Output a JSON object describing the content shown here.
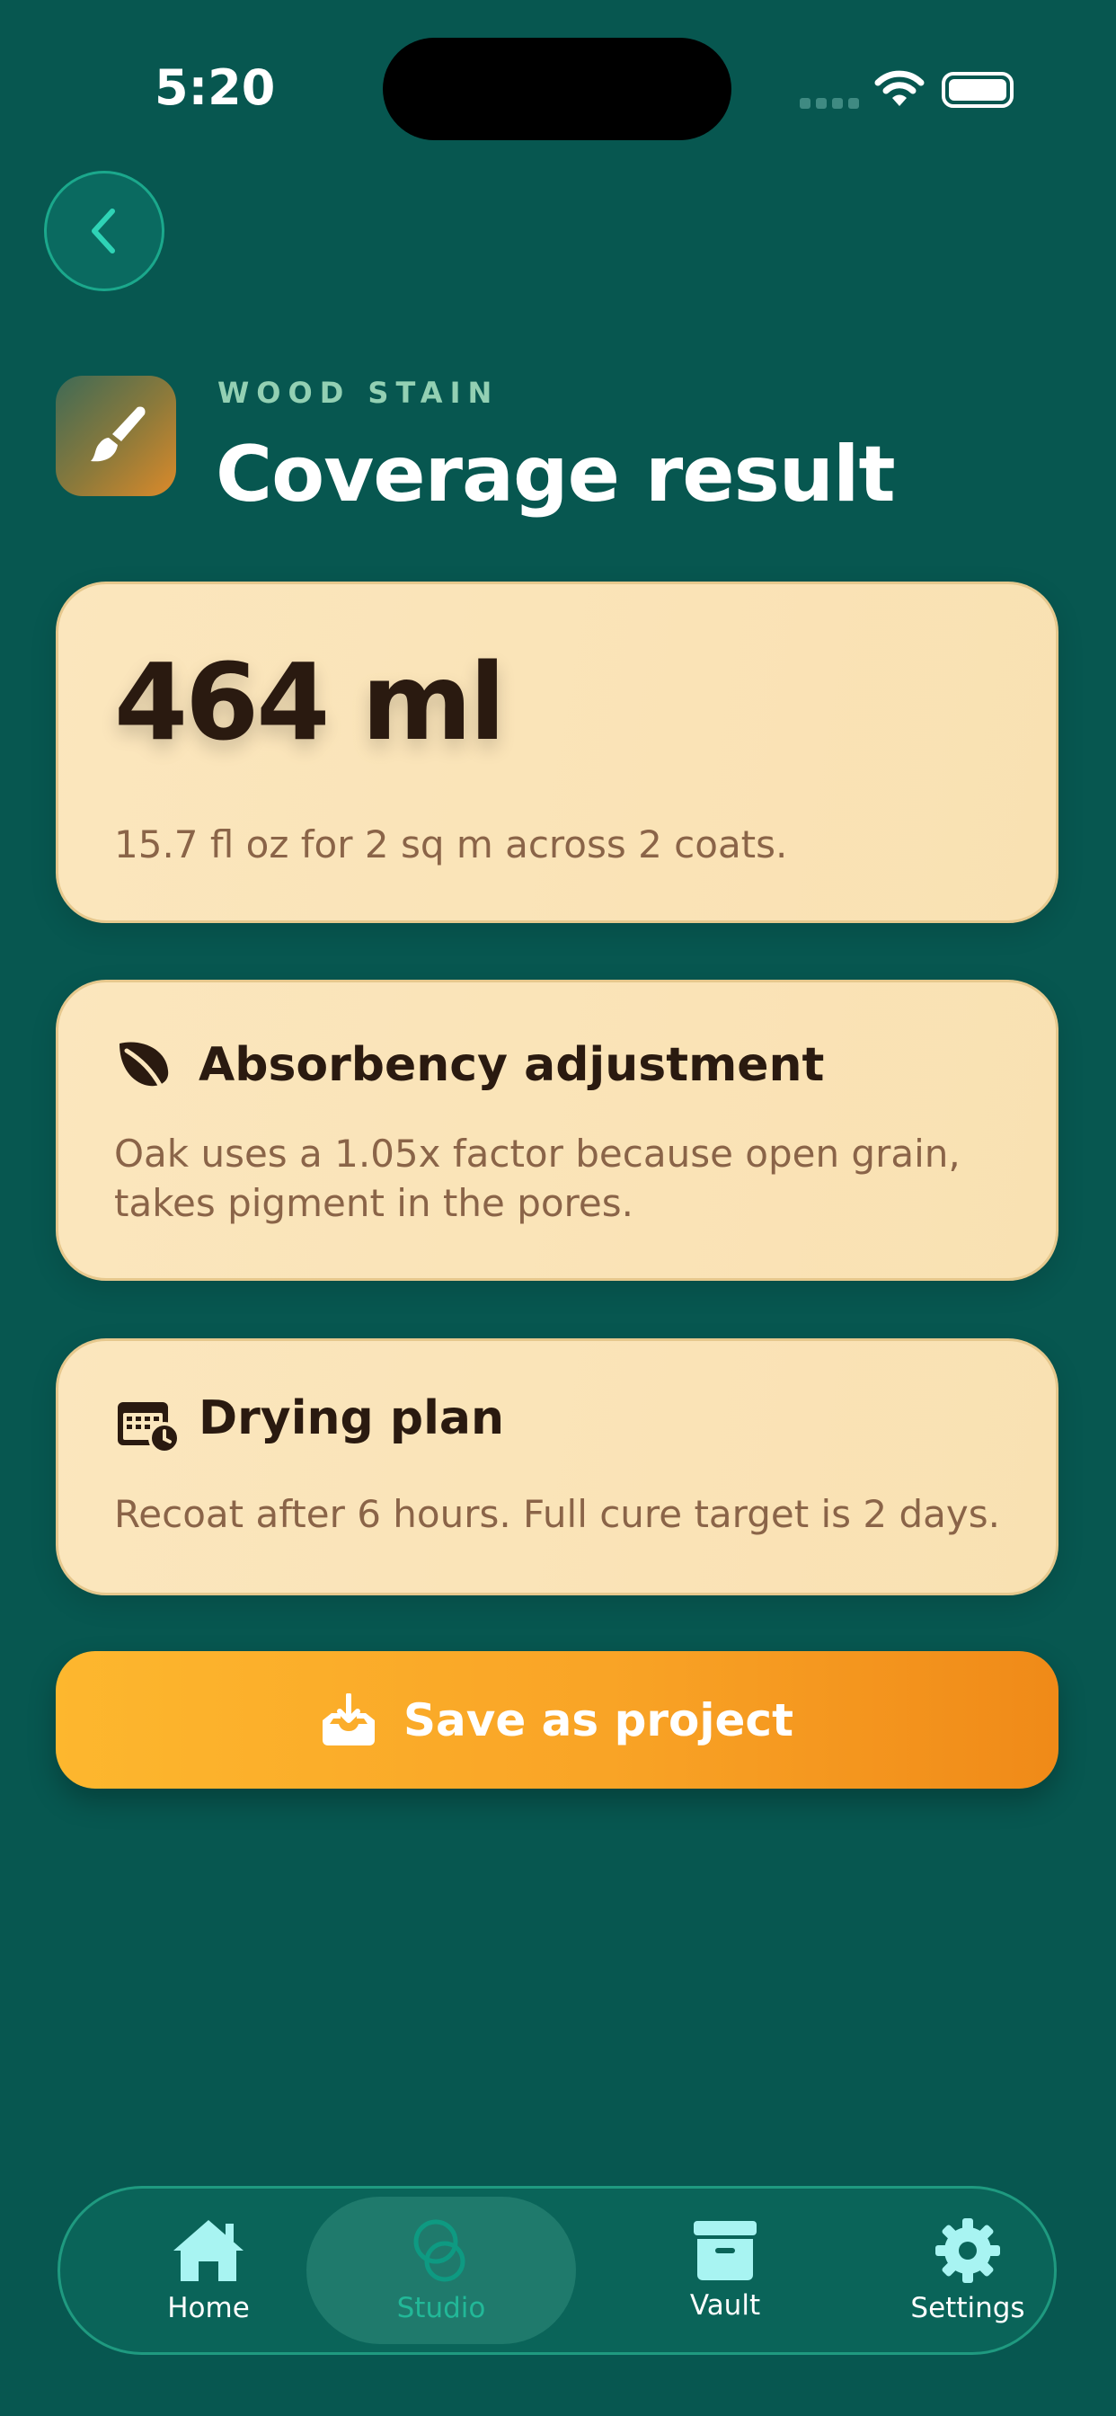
{
  "status_bar": {
    "time": "5:20"
  },
  "header": {
    "eyebrow": "WOOD STAIN",
    "title": "Coverage result",
    "icon": "paintbrush-icon"
  },
  "result": {
    "amount": "464 ml",
    "detail": "15.7 fl oz for 2 sq m across 2 coats."
  },
  "absorbency": {
    "icon": "leaf-icon",
    "heading": "Absorbency adjustment",
    "line1": "Oak uses a 1.05x factor because open grain,",
    "line2": "takes pigment in the pores."
  },
  "drying": {
    "icon": "calendar-clock-icon",
    "heading": "Drying plan",
    "text": "Recoat after 6 hours. Full cure target is 2 days."
  },
  "cta": {
    "label": "Save as project",
    "icon": "tray-download-icon"
  },
  "tabs": [
    {
      "label": "Home",
      "icon": "house-icon",
      "active": false
    },
    {
      "label": "Studio",
      "icon": "circles-icon",
      "active": true
    },
    {
      "label": "Vault",
      "icon": "archive-box-icon",
      "active": false
    },
    {
      "label": "Settings",
      "icon": "gear-icon",
      "active": false
    }
  ],
  "colors": {
    "background": "#075750",
    "card": "#fbe6bd",
    "accent": "#f9a426",
    "eyebrow": "#93d0b3"
  }
}
